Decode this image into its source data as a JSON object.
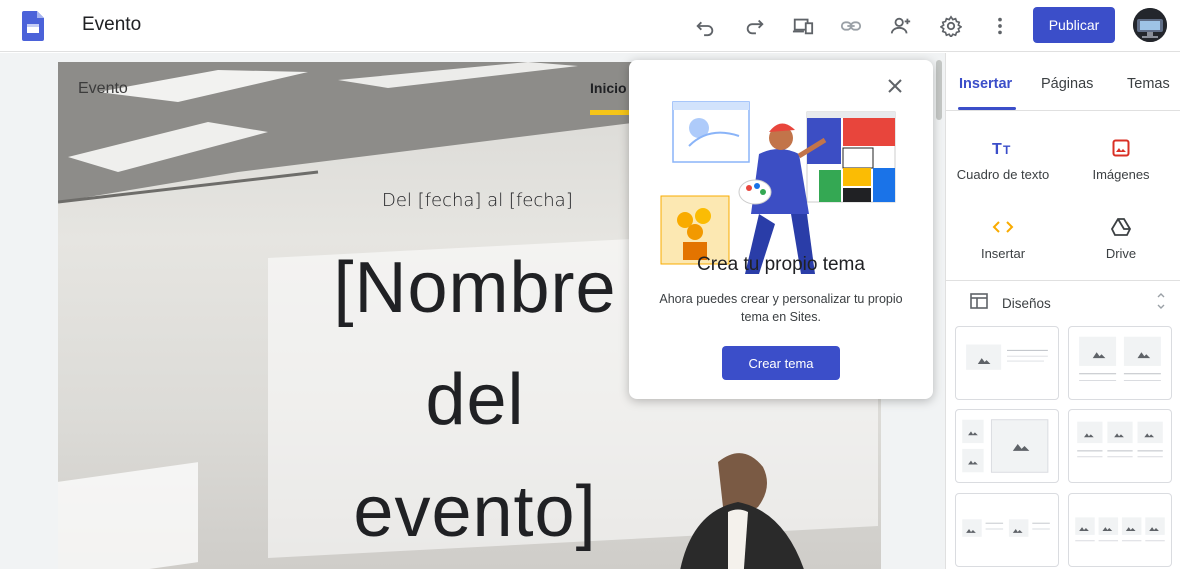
{
  "header": {
    "title": "Evento",
    "publish_label": "Publicar",
    "icons": [
      "undo-icon",
      "redo-icon",
      "preview-devices-icon",
      "link-icon",
      "share-person-add-icon",
      "settings-gear-icon",
      "more-vert-icon"
    ]
  },
  "site": {
    "name": "Evento",
    "nav_item": "Inicio",
    "date_text": "Del [fecha] al [fecha]",
    "title_lines": [
      "[Nombre",
      "del",
      "evento]"
    ]
  },
  "popup": {
    "title": "Crea tu propio tema",
    "description": "Ahora puedes crear y personalizar tu propio tema en Sites.",
    "button_label": "Crear tema"
  },
  "panel": {
    "tabs": [
      "Insertar",
      "Páginas",
      "Temas"
    ],
    "active_tab": "Insertar",
    "tools": [
      {
        "label": "Cuadro de texto",
        "icon": "text-box-icon"
      },
      {
        "label": "Imágenes",
        "icon": "image-icon"
      },
      {
        "label": "Insertar",
        "icon": "embed-code-icon"
      },
      {
        "label": "Drive",
        "icon": "drive-icon"
      }
    ],
    "designs_label": "Diseños"
  },
  "colors": {
    "accent": "#3b4ec9",
    "nav_underline": "#f5c518",
    "image_icon": "#d93025",
    "embed_icon": "#f9ab00"
  }
}
